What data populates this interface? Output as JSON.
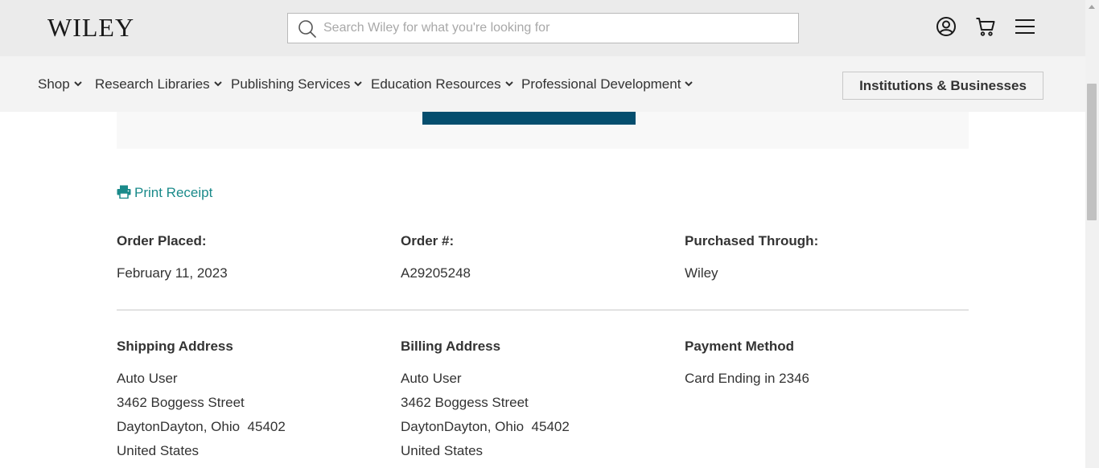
{
  "header": {
    "logo_text": "WILEY",
    "search_placeholder": "Search Wiley for what you're looking for"
  },
  "nav": {
    "items": [
      {
        "label": "Shop"
      },
      {
        "label": "Research Libraries"
      },
      {
        "label": "Publishing Services"
      },
      {
        "label": "Education Resources"
      },
      {
        "label": "Professional Development"
      }
    ],
    "institutions_button": "Institutions & Businesses"
  },
  "order": {
    "print_receipt": "Print Receipt",
    "order_placed_label": "Order Placed:",
    "order_placed_value": "February 11, 2023",
    "order_number_label": "Order #:",
    "order_number_value": "A29205248",
    "purchased_through_label": "Purchased Through:",
    "purchased_through_value": "Wiley"
  },
  "shipping": {
    "label": "Shipping Address",
    "name": "Auto User",
    "street": "3462 Boggess Street",
    "city_line": "DaytonDayton, Ohio  45402",
    "country": "United States"
  },
  "billing": {
    "label": "Billing Address",
    "name": "Auto User",
    "street": "3462 Boggess Street",
    "city_line": "DaytonDayton, Ohio  45402",
    "country": "United States"
  },
  "payment": {
    "label": "Payment Method",
    "value": "Card Ending in 2346"
  },
  "colors": {
    "accent_teal": "#1a8a8a",
    "dark_button": "#054e6e",
    "header_bg": "#ebebeb",
    "nav_bg": "#f3f3f3"
  }
}
